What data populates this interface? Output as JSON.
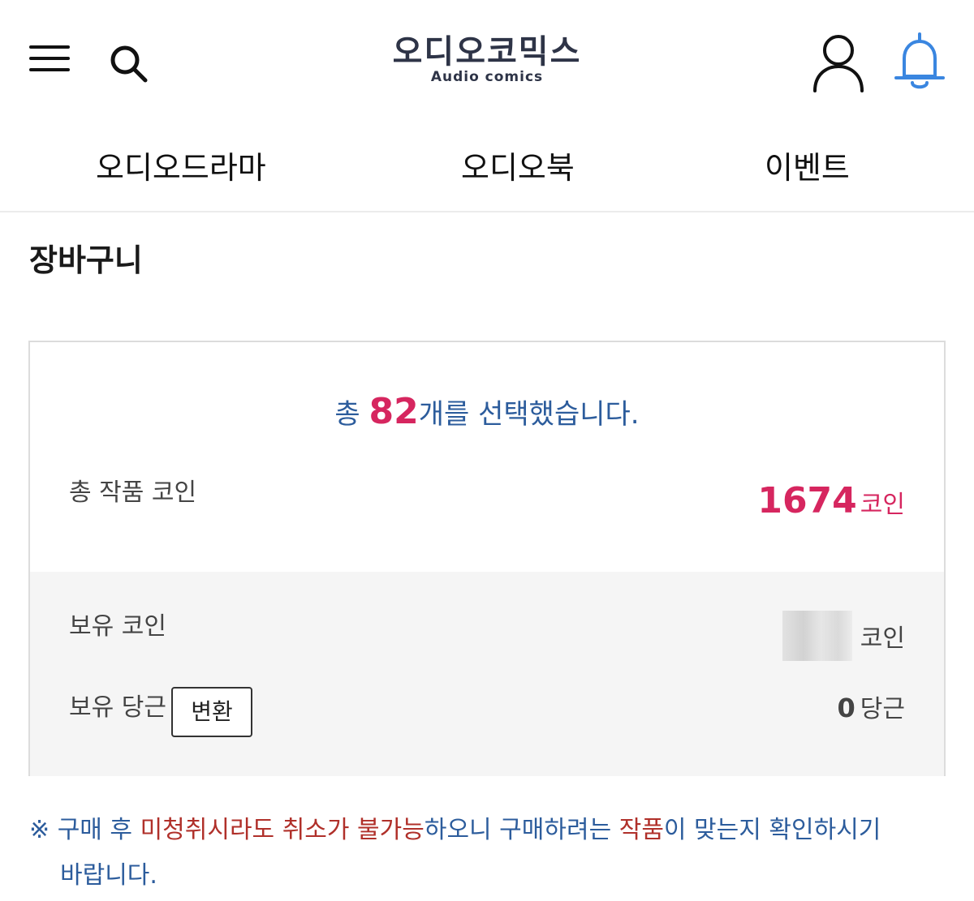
{
  "header": {
    "logo_korean": "오디오코믹스",
    "logo_english": "Audio comics",
    "icons": [
      "menu-icon",
      "search-icon",
      "user-icon",
      "bell-icon"
    ],
    "bell_color": "#3a86e0"
  },
  "nav": {
    "items": [
      {
        "label": "오디오드라마"
      },
      {
        "label": "오디오북"
      },
      {
        "label": "이벤트"
      }
    ]
  },
  "page": {
    "title": "장바구니"
  },
  "cart": {
    "summary_prefix": "총 ",
    "selected_count": "82",
    "summary_suffix": "개를 선택했습니다.",
    "total_label": "총 작품 코인",
    "total_coins": "1674",
    "coin_unit": "코인",
    "own_coin_label": "보유 코인",
    "own_coin_unit": "코인",
    "own_carrot_label": "보유 당근",
    "convert_button": "변환",
    "own_carrots": "0",
    "carrot_unit": "당근"
  },
  "notice": {
    "mark": "※ ",
    "p1": "구매 후 ",
    "p2": "미청취시라도 취소가 불가능",
    "p3": "하오니 구매하려는 ",
    "p4": "작품",
    "p5": "이 맞는지 확인하시기",
    "p6": "바랍니다."
  },
  "colors": {
    "accent_pink": "#d6265f",
    "notice_blue": "#2c5c9c",
    "notice_red": "#b0302a",
    "logo_navy": "#2e3447"
  }
}
